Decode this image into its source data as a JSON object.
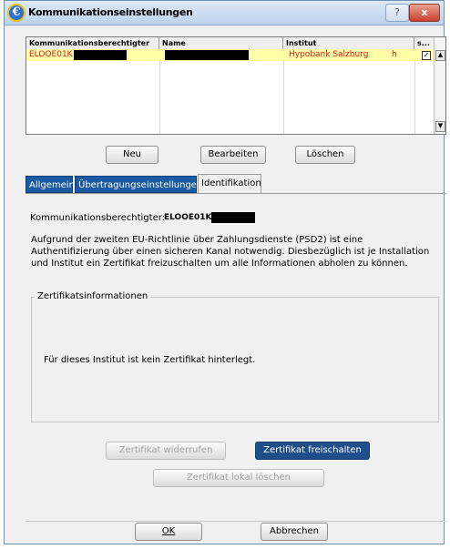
{
  "window": {
    "title": "Kommunikationseinstellungen",
    "help_label": "?",
    "close_label": "x",
    "app_icon": "€"
  },
  "grid": {
    "columns": [
      "Kommunikationsberechtigter",
      "Name",
      "Institut",
      "s..."
    ],
    "rows": [
      {
        "berechtigter": "ELOOE01K",
        "name": "",
        "institut": "Hypobank Salzburg",
        "extra": "h",
        "checked": "✓"
      }
    ],
    "scroll_up": "▲",
    "scroll_down": "▼"
  },
  "actions": {
    "neu": "Neu",
    "bearbeiten": "Bearbeiten",
    "loeschen": "Löschen"
  },
  "tabs": [
    {
      "label": "Allgemein",
      "active": false
    },
    {
      "label": "Übertragungseinstellungen",
      "active": false
    },
    {
      "label": "Identifikation",
      "active": true
    }
  ],
  "identifikation": {
    "berechtigter_label": "Kommunikationsberechtigter:",
    "berechtigter_value": "ELOOE01K",
    "info_text": "Aufgrund der zweiten EU-Richtlinie über Zahlungsdienste (PSD2) ist eine Authentifizierung über einen sicheren Kanal notwendig. Diesbezüglich ist je Installation und Institut ein Zertifikat freizuschalten um alle Informationen abholen zu können.",
    "group_title": "Zertifikatsinformationen",
    "no_cert_text": "Für dieses Institut ist kein Zertifikat hinterlegt.",
    "btn_widerrufen": "Zertifikat widerrufen",
    "btn_freischalten": "Zertifikat freischalten",
    "btn_lokal_loeschen": "Zertifikat lokal löschen"
  },
  "footer": {
    "ok": "OK",
    "abbrechen": "Abbrechen"
  }
}
